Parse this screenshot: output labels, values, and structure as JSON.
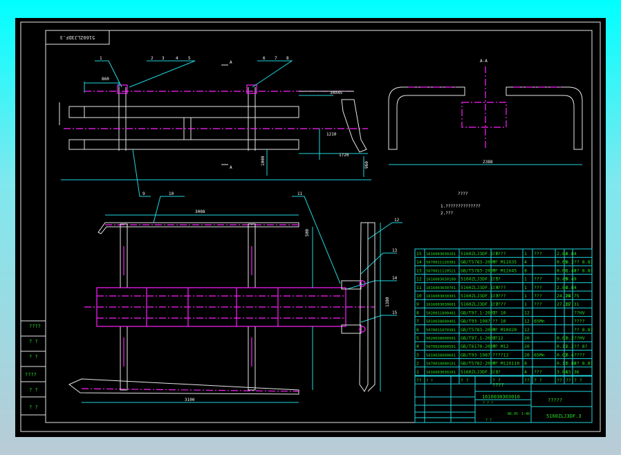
{
  "drawing_number": "5160ZLJ3DF.3",
  "section_label": "A-A",
  "section_mark": "A",
  "balloons": [
    "1",
    "2",
    "3",
    "4",
    "5",
    "6",
    "7",
    "8",
    "9",
    "10",
    "11",
    "12",
    "13",
    "14",
    "15"
  ],
  "notes": {
    "heading": "????",
    "line1": "1.??????????????",
    "line2": "2.???"
  },
  "dimensions": {
    "d1": "860",
    "d2": "2388",
    "d3": "3008",
    "d4": "3100",
    "d5": "1720",
    "d6": "1380",
    "d7": "1000",
    "d8": "960",
    "d9": "500",
    "d10": "30X45",
    "d11": "1210"
  },
  "parts_table": {
    "rows": [
      [
        "15",
        "1616003030201",
        "5160ZLJ3DF.1.6",
        "?????",
        "1",
        "???",
        "2.84",
        "2.84",
        ""
      ],
      [
        "14",
        "5070011120381",
        "GB/T5783-2000",
        "?? M12X35",
        "4",
        "",
        "0.05",
        "0.2",
        "?? 8.8?"
      ],
      [
        "13",
        "5070011120521",
        "GB/T5783-2000",
        "?? M12X45",
        "8",
        "",
        "0.06",
        "1.48",
        "?? 8.8?"
      ],
      [
        "12",
        "1616003030100",
        "5160ZLJ3DF.1.5",
        "???",
        "1",
        "???",
        "9.49",
        "9.49",
        ""
      ],
      [
        "11",
        "1616003030701",
        "5160ZLJ3DF.1.4",
        "?????",
        "1",
        "???",
        "2.84",
        "2.84",
        ""
      ],
      [
        "10",
        "1616003030301",
        "5160ZLJ3DF.1.3",
        "?????",
        "1",
        "???",
        "24.75",
        "24.75",
        ""
      ],
      [
        "9",
        "1616003030601",
        "5160ZLJ3DF.1.2",
        "?????",
        "1",
        "???",
        "27.31",
        "27.31",
        ""
      ],
      [
        "8",
        "5020011800401",
        "GB/T97.1-2002",
        "?? 10",
        "12",
        "",
        "",
        "",
        "??HV"
      ],
      [
        "7",
        "5010038000401",
        "GB/T93-1987",
        "?? 10",
        "12",
        "65Mn",
        "",
        "",
        "????"
      ],
      [
        "6",
        "5070011070381",
        "GB/T5783-2000",
        "?? M10X20",
        "12",
        "",
        "",
        "",
        "?? 8.8?"
      ],
      [
        "5",
        "5020038000501",
        "GB/T97.1-2002",
        "??12",
        "20",
        "",
        "0.01",
        "0.2",
        "??HV"
      ],
      [
        "4",
        "5070020000501",
        "GB/T6170-2000",
        "?? M12",
        "20",
        "",
        "0.11",
        "2.2",
        "?? 8?"
      ],
      [
        "3",
        "5010038000601",
        "GB/T93-1987",
        "????12",
        "20",
        "65Mn",
        "0.02",
        "0.4",
        "????"
      ],
      [
        "2",
        "5070010080101",
        "GB/T5782-2000",
        "?? M12X110",
        "8",
        "",
        "0.11",
        "0.88",
        "?? 8.8?"
      ],
      [
        "1",
        "1616003030201",
        "5160ZLJ3DF.1.1",
        "???",
        "4",
        "???",
        "3.84",
        "15.36",
        ""
      ]
    ],
    "header": [
      "??",
      "?  ?",
      "?  ?",
      "?  ?",
      "??",
      "?  ?",
      "??",
      "??",
      "?  ?"
    ]
  },
  "title_block": {
    "name": "????",
    "code": "1616030303010",
    "company": "?????",
    "number": "5160ZLJ3DF.3",
    "weight": "86.95",
    "scale": "1:40",
    "stage": "?  ?  ?",
    "sheet": "?    ?"
  },
  "side_block": [
    "????",
    "? ?",
    "? ?",
    "????",
    "? ?",
    "? ?"
  ]
}
